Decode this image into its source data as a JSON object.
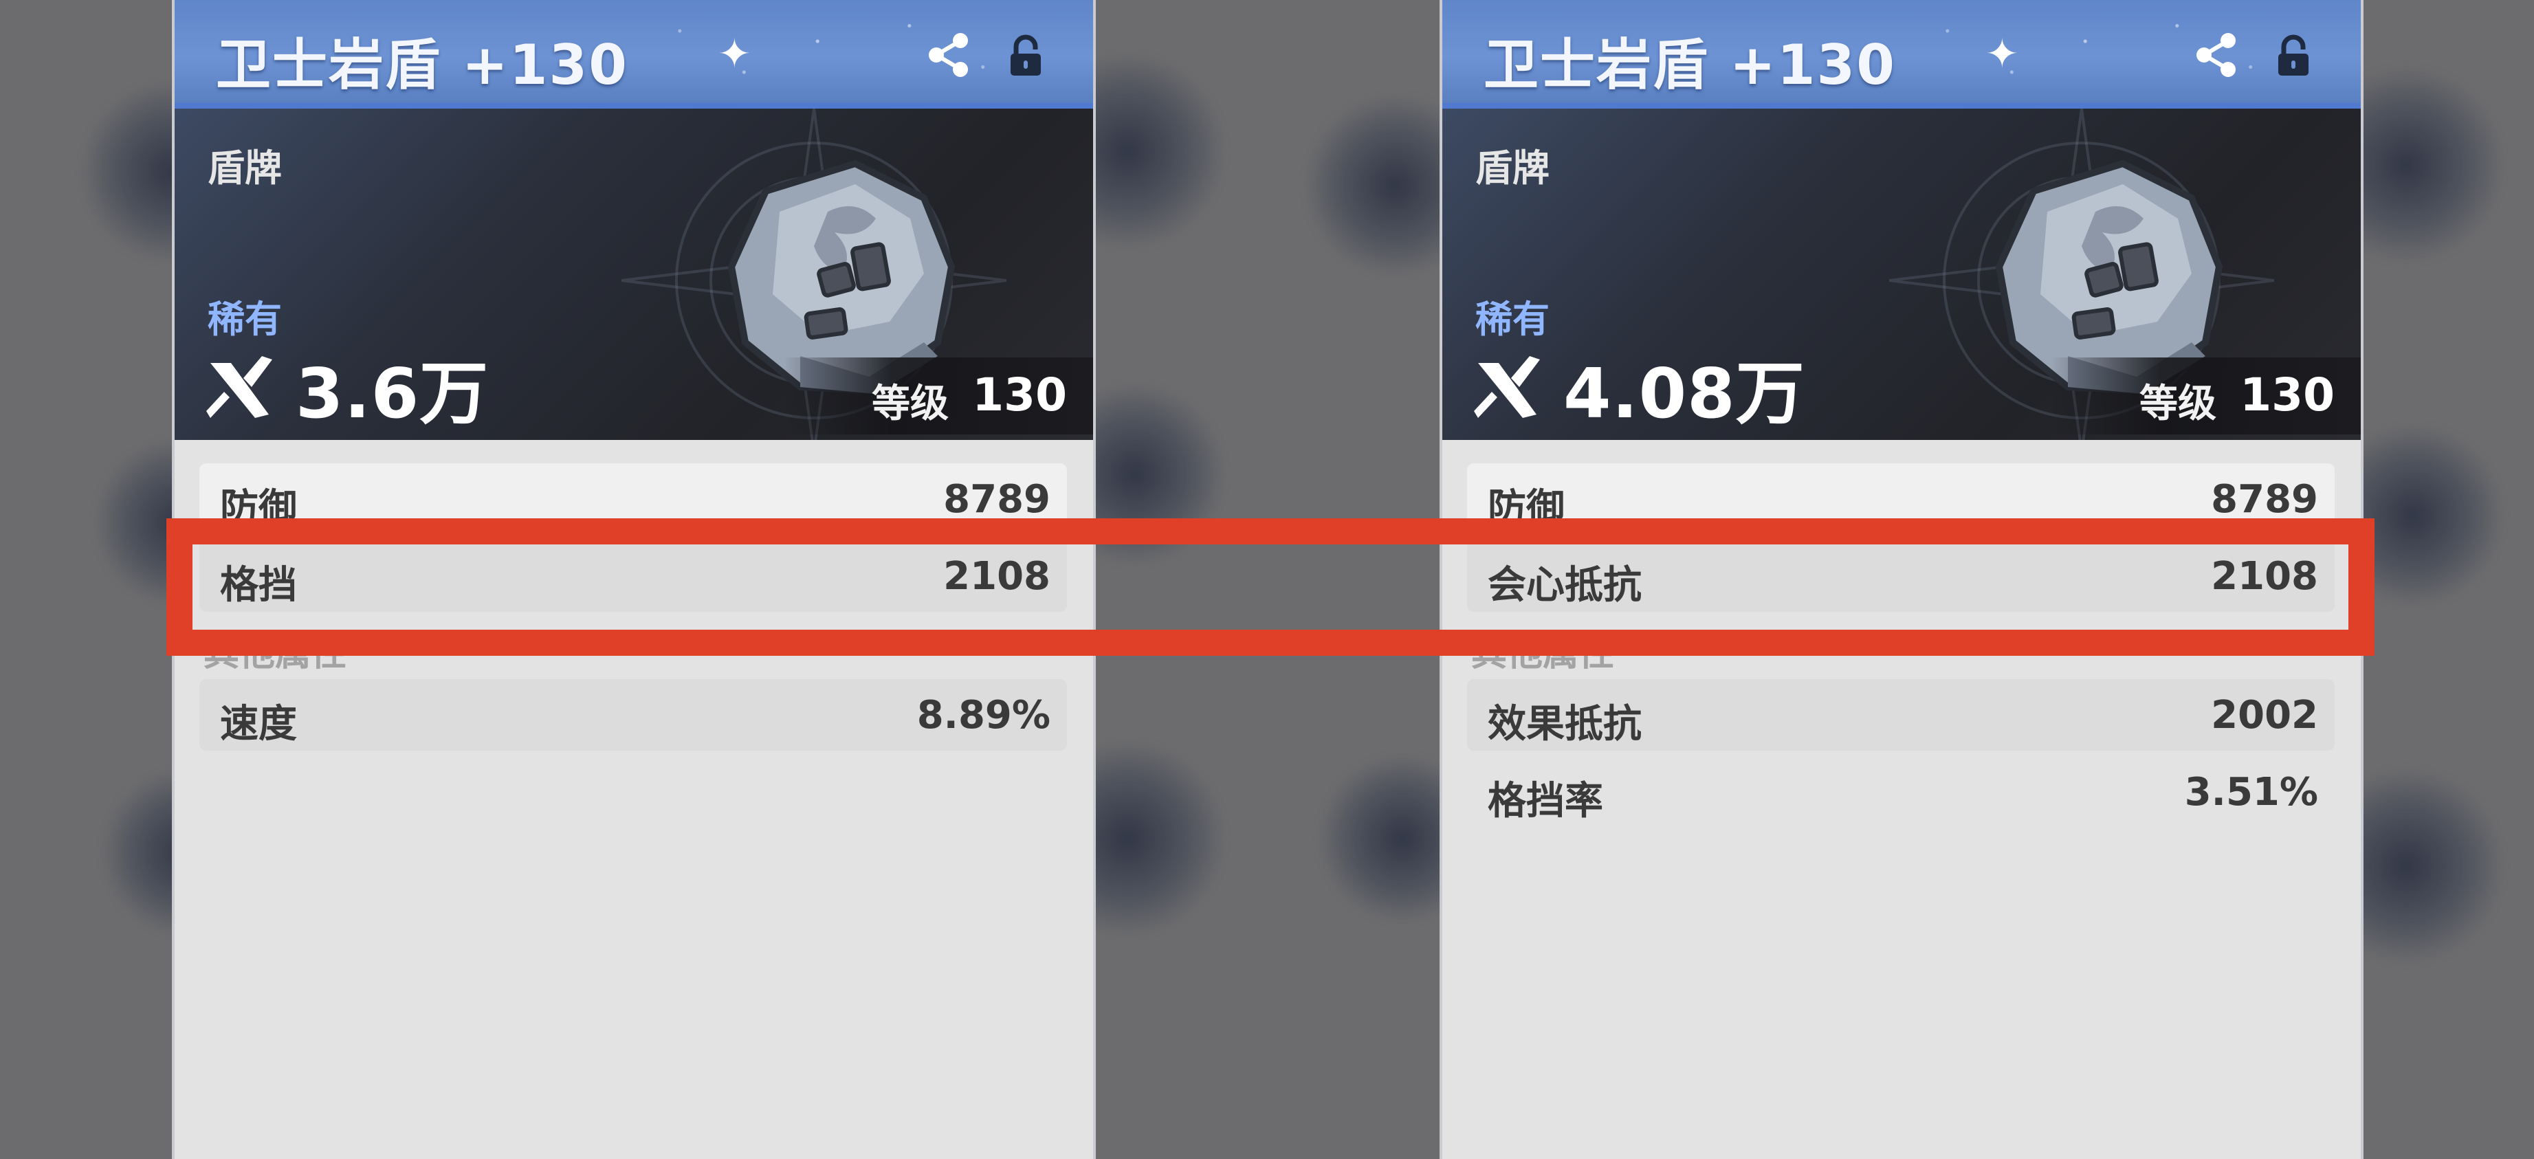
{
  "cards": [
    {
      "title": "卫士岩盾 +130",
      "type": "盾牌",
      "rarity": "稀有",
      "power": "3.6万",
      "level_label": "等级",
      "level": "130",
      "main_stats": [
        {
          "name": "防御",
          "value": "8789"
        },
        {
          "name": "格挡",
          "value": "2108"
        }
      ],
      "other_label": "其他属性",
      "other_stats": [
        {
          "name": "速度",
          "value": "8.89%"
        }
      ]
    },
    {
      "title": "卫士岩盾 +130",
      "type": "盾牌",
      "rarity": "稀有",
      "power": "4.08万",
      "level_label": "等级",
      "level": "130",
      "main_stats": [
        {
          "name": "防御",
          "value": "8789"
        },
        {
          "name": "会心抵抗",
          "value": "2108"
        }
      ],
      "other_label": "其他属性",
      "other_stats": [
        {
          "name": "效果抵抗",
          "value": "2002"
        },
        {
          "name": "格挡率",
          "value": "3.51%"
        }
      ]
    }
  ],
  "icons": {
    "share": "share-icon",
    "lock": "lock-icon",
    "power": "crossed-swords-icon",
    "item": "rock-shield-icon"
  },
  "colors": {
    "header_blue": "#6d93d4",
    "rarity_blue": "#8fb6ff",
    "highlight_red": "#e14028"
  }
}
